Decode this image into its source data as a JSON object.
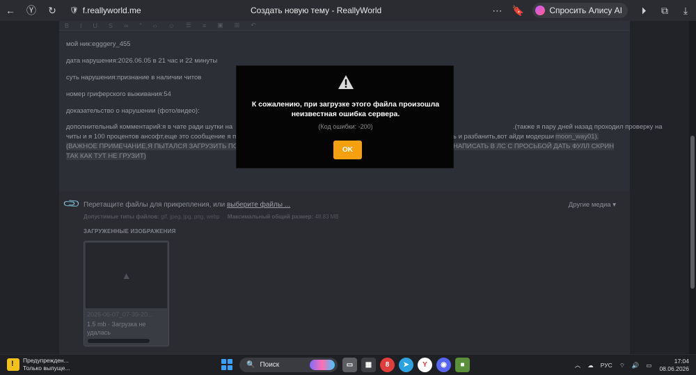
{
  "browser": {
    "url": "f.reallyworld.me",
    "tab_title": "Создать новую тему - ReallyWorld",
    "alice_label": "Спросить Алису AI"
  },
  "editor": {
    "lines": [
      "мой ник:egggery_455",
      "дата нарушения:2026.06.05 в 21 час и 22 минуты",
      "суть нарушения:признание в наличии читов",
      "номер гриферского выживания:54",
      "доказательство о нарушении (фото/видео):"
    ],
    "comment_start": "дополнительный комментарий:я в чате ради шутки на",
    "comment_right": ".(также я пару дней назад проходил проверку на",
    "comment_line2_left": "читы и я 100 процентов ансофт,еще это сообщение я п",
    "comment_line2_right": "ь и разбанить,вот айди модерши",
    "moder_id": "moon_way01).",
    "caps_line1_left": "(ВАЖНОЕ ПРИМЕЧАНИЕ,Я ПЫТАЛСЯ ЗАГРУЗИТЬ ПОЛ",
    "caps_line1_right": "НАПИСАТЬ В ЛС С ПРОСЬБОЙ ДАТЬ ФУЛЛ СКРИН",
    "caps_line2": "ТАК КАК ТУТ НЕ ГРУЗИТ)"
  },
  "attachments": {
    "drop_text": "Перетащите файлы для прикрепления, или",
    "drop_link": "выберите файлы ...",
    "other_media": "Другие медиа ▾",
    "allowed_label": "Допустимые типы файлов:",
    "allowed_types": "gif, jpeg, jpg, png, webp",
    "max_size_label": "Максимальный общий размер:",
    "max_size": "48.83 MB",
    "uploaded_heading": "ЗАГРУЖЕННЫЕ ИЗОБРАЖЕНИЯ",
    "file_name": "2026-06-07_07-39-20...",
    "file_status": "1.5 mb · Загрузка не удалась"
  },
  "modal": {
    "message": "К сожалению, при загрузке этого файла произошла неизвестная ошибка сервера.",
    "code": "(Код ошибки: -200)",
    "ok_label": "OK"
  },
  "taskbar": {
    "notif_title": "Предупрежден...",
    "notif_sub": "Только выпуще...",
    "search_label": "Поиск",
    "lang": "РУС",
    "time": "17:04",
    "date": "08.06.2026"
  }
}
